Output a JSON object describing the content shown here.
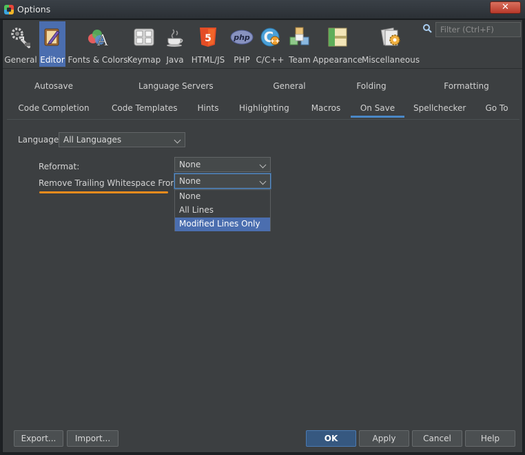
{
  "window": {
    "title": "Options",
    "close_glyph": "✕"
  },
  "search": {
    "placeholder": "Filter (Ctrl+F)",
    "icon": "search-icon"
  },
  "categories": [
    {
      "label": "General",
      "icon": "wrench-gear-icon"
    },
    {
      "label": "Editor",
      "icon": "editor-pencil-icon",
      "selected": true
    },
    {
      "label": "Fonts & Colors",
      "icon": "fonts-colors-icon"
    },
    {
      "label": "Keymap",
      "icon": "keyboard-icon"
    },
    {
      "label": "Java",
      "icon": "java-cup-icon"
    },
    {
      "label": "HTML/JS",
      "icon": "html5-icon"
    },
    {
      "label": "PHP",
      "icon": "php-icon"
    },
    {
      "label": "C/C++",
      "icon": "cpp-icon"
    },
    {
      "label": "Team",
      "icon": "team-cubes-icon"
    },
    {
      "label": "Appearance",
      "icon": "appearance-layout-icon"
    },
    {
      "label": "Miscellaneous",
      "icon": "misc-gear-icon"
    }
  ],
  "tabs_row1": [
    "Autosave",
    "Language Servers",
    "General",
    "Folding",
    "Formatting"
  ],
  "tabs_row2": [
    "Code Completion",
    "Code Templates",
    "Hints",
    "Highlighting",
    "Macros",
    "On Save",
    "Spellchecker",
    "Go To"
  ],
  "active_tab": "On Save",
  "form": {
    "language_label": "Language:",
    "language_value": "All Languages",
    "reformat_label": "Reformat:",
    "reformat_value": "None",
    "whitespace_label": "Remove Trailing Whitespace From:",
    "whitespace_value": "None",
    "whitespace_options": [
      "None",
      "All Lines",
      "Modified Lines Only"
    ],
    "whitespace_highlighted_option": "Modified Lines Only"
  },
  "buttons": {
    "export": "Export...",
    "import": "Import...",
    "ok": "OK",
    "apply": "Apply",
    "cancel": "Cancel",
    "help": "Help"
  },
  "colors": {
    "background": "#3c3f41",
    "selection": "#4b6eaf",
    "tab_underline": "#4a88c7",
    "annotation_underline": "#f08c1c",
    "ok_button": "#365880"
  }
}
